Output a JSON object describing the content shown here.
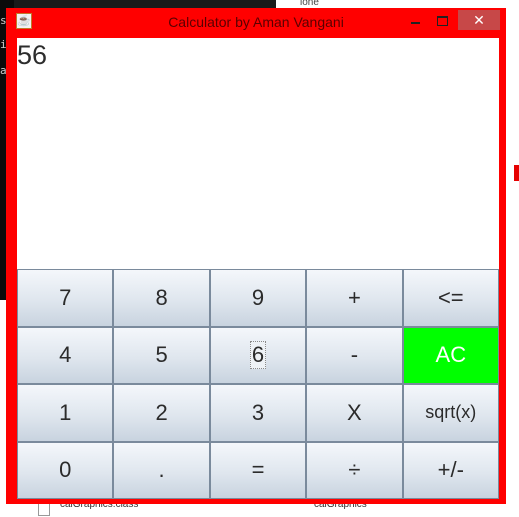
{
  "window": {
    "title": "Calculator by Aman Vangani",
    "minimize_label": "",
    "close_label": "✕"
  },
  "display": {
    "value": "56"
  },
  "keys": [
    {
      "label": "7"
    },
    {
      "label": "8"
    },
    {
      "label": "9"
    },
    {
      "label": "+"
    },
    {
      "label": "<="
    },
    {
      "label": "4"
    },
    {
      "label": "5"
    },
    {
      "label": "6"
    },
    {
      "label": "-"
    },
    {
      "label": "AC"
    },
    {
      "label": "1"
    },
    {
      "label": "2"
    },
    {
      "label": "3"
    },
    {
      "label": "X"
    },
    {
      "label": "sqrt(x)"
    },
    {
      "label": "0"
    },
    {
      "label": "."
    },
    {
      "label": "="
    },
    {
      "label": "÷"
    },
    {
      "label": "+/-"
    }
  ],
  "colors": {
    "window_border": "#ff0000",
    "ac_key": "#00ff00"
  },
  "background": {
    "terminal_chars": [
      "se",
      "il",
      "av"
    ],
    "top_text": "ione",
    "file_left": "calGraphics.class",
    "file_right": "calGraphics"
  }
}
